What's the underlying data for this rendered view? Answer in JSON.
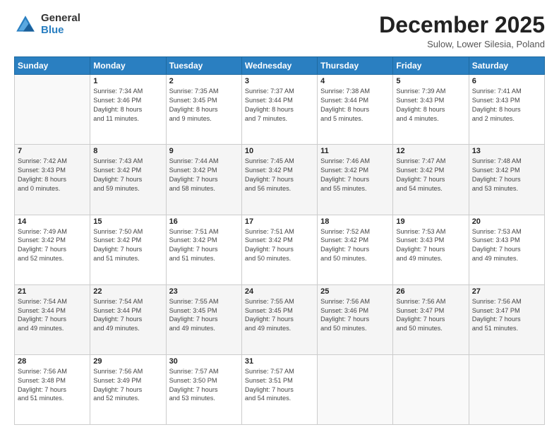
{
  "logo": {
    "general": "General",
    "blue": "Blue"
  },
  "header": {
    "month": "December 2025",
    "location": "Sulow, Lower Silesia, Poland"
  },
  "weekdays": [
    "Sunday",
    "Monday",
    "Tuesday",
    "Wednesday",
    "Thursday",
    "Friday",
    "Saturday"
  ],
  "weeks": [
    [
      {
        "day": "",
        "info": ""
      },
      {
        "day": "1",
        "info": "Sunrise: 7:34 AM\nSunset: 3:46 PM\nDaylight: 8 hours\nand 11 minutes."
      },
      {
        "day": "2",
        "info": "Sunrise: 7:35 AM\nSunset: 3:45 PM\nDaylight: 8 hours\nand 9 minutes."
      },
      {
        "day": "3",
        "info": "Sunrise: 7:37 AM\nSunset: 3:44 PM\nDaylight: 8 hours\nand 7 minutes."
      },
      {
        "day": "4",
        "info": "Sunrise: 7:38 AM\nSunset: 3:44 PM\nDaylight: 8 hours\nand 5 minutes."
      },
      {
        "day": "5",
        "info": "Sunrise: 7:39 AM\nSunset: 3:43 PM\nDaylight: 8 hours\nand 4 minutes."
      },
      {
        "day": "6",
        "info": "Sunrise: 7:41 AM\nSunset: 3:43 PM\nDaylight: 8 hours\nand 2 minutes."
      }
    ],
    [
      {
        "day": "7",
        "info": "Sunrise: 7:42 AM\nSunset: 3:43 PM\nDaylight: 8 hours\nand 0 minutes."
      },
      {
        "day": "8",
        "info": "Sunrise: 7:43 AM\nSunset: 3:42 PM\nDaylight: 7 hours\nand 59 minutes."
      },
      {
        "day": "9",
        "info": "Sunrise: 7:44 AM\nSunset: 3:42 PM\nDaylight: 7 hours\nand 58 minutes."
      },
      {
        "day": "10",
        "info": "Sunrise: 7:45 AM\nSunset: 3:42 PM\nDaylight: 7 hours\nand 56 minutes."
      },
      {
        "day": "11",
        "info": "Sunrise: 7:46 AM\nSunset: 3:42 PM\nDaylight: 7 hours\nand 55 minutes."
      },
      {
        "day": "12",
        "info": "Sunrise: 7:47 AM\nSunset: 3:42 PM\nDaylight: 7 hours\nand 54 minutes."
      },
      {
        "day": "13",
        "info": "Sunrise: 7:48 AM\nSunset: 3:42 PM\nDaylight: 7 hours\nand 53 minutes."
      }
    ],
    [
      {
        "day": "14",
        "info": "Sunrise: 7:49 AM\nSunset: 3:42 PM\nDaylight: 7 hours\nand 52 minutes."
      },
      {
        "day": "15",
        "info": "Sunrise: 7:50 AM\nSunset: 3:42 PM\nDaylight: 7 hours\nand 51 minutes."
      },
      {
        "day": "16",
        "info": "Sunrise: 7:51 AM\nSunset: 3:42 PM\nDaylight: 7 hours\nand 51 minutes."
      },
      {
        "day": "17",
        "info": "Sunrise: 7:51 AM\nSunset: 3:42 PM\nDaylight: 7 hours\nand 50 minutes."
      },
      {
        "day": "18",
        "info": "Sunrise: 7:52 AM\nSunset: 3:42 PM\nDaylight: 7 hours\nand 50 minutes."
      },
      {
        "day": "19",
        "info": "Sunrise: 7:53 AM\nSunset: 3:43 PM\nDaylight: 7 hours\nand 49 minutes."
      },
      {
        "day": "20",
        "info": "Sunrise: 7:53 AM\nSunset: 3:43 PM\nDaylight: 7 hours\nand 49 minutes."
      }
    ],
    [
      {
        "day": "21",
        "info": "Sunrise: 7:54 AM\nSunset: 3:44 PM\nDaylight: 7 hours\nand 49 minutes."
      },
      {
        "day": "22",
        "info": "Sunrise: 7:54 AM\nSunset: 3:44 PM\nDaylight: 7 hours\nand 49 minutes."
      },
      {
        "day": "23",
        "info": "Sunrise: 7:55 AM\nSunset: 3:45 PM\nDaylight: 7 hours\nand 49 minutes."
      },
      {
        "day": "24",
        "info": "Sunrise: 7:55 AM\nSunset: 3:45 PM\nDaylight: 7 hours\nand 49 minutes."
      },
      {
        "day": "25",
        "info": "Sunrise: 7:56 AM\nSunset: 3:46 PM\nDaylight: 7 hours\nand 50 minutes."
      },
      {
        "day": "26",
        "info": "Sunrise: 7:56 AM\nSunset: 3:47 PM\nDaylight: 7 hours\nand 50 minutes."
      },
      {
        "day": "27",
        "info": "Sunrise: 7:56 AM\nSunset: 3:47 PM\nDaylight: 7 hours\nand 51 minutes."
      }
    ],
    [
      {
        "day": "28",
        "info": "Sunrise: 7:56 AM\nSunset: 3:48 PM\nDaylight: 7 hours\nand 51 minutes."
      },
      {
        "day": "29",
        "info": "Sunrise: 7:56 AM\nSunset: 3:49 PM\nDaylight: 7 hours\nand 52 minutes."
      },
      {
        "day": "30",
        "info": "Sunrise: 7:57 AM\nSunset: 3:50 PM\nDaylight: 7 hours\nand 53 minutes."
      },
      {
        "day": "31",
        "info": "Sunrise: 7:57 AM\nSunset: 3:51 PM\nDaylight: 7 hours\nand 54 minutes."
      },
      {
        "day": "",
        "info": ""
      },
      {
        "day": "",
        "info": ""
      },
      {
        "day": "",
        "info": ""
      }
    ]
  ]
}
